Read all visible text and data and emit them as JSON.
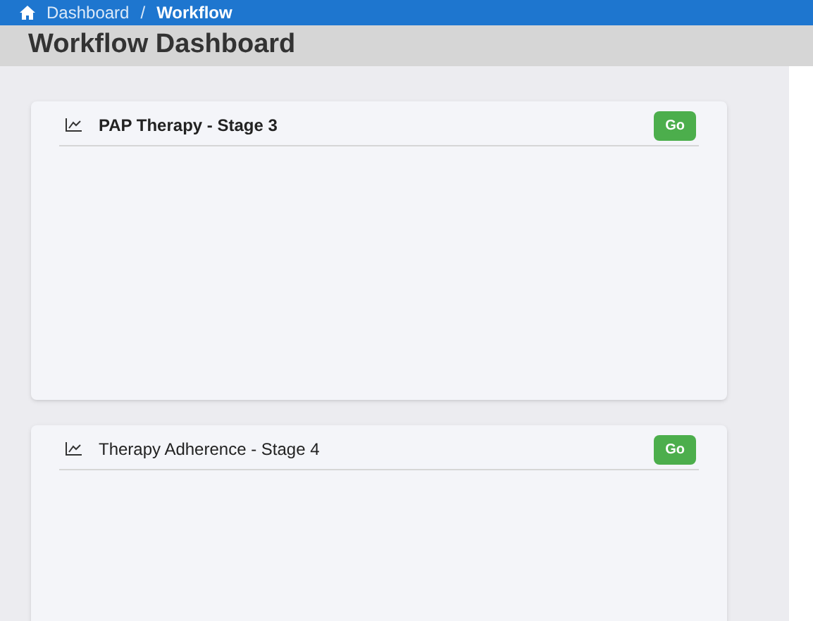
{
  "breadcrumb": [
    {
      "label": "Dashboard",
      "current": false
    },
    {
      "label": "/",
      "current": false
    },
    {
      "label": "Workflow",
      "current": true
    }
  ],
  "page_title": "Workflow Dashboard",
  "cards": [
    {
      "title": "PAP Therapy - Stage 3",
      "bold": true,
      "button": "Go"
    },
    {
      "title": "Therapy Adherence - Stage 4",
      "bold": false,
      "button": "Go"
    }
  ]
}
